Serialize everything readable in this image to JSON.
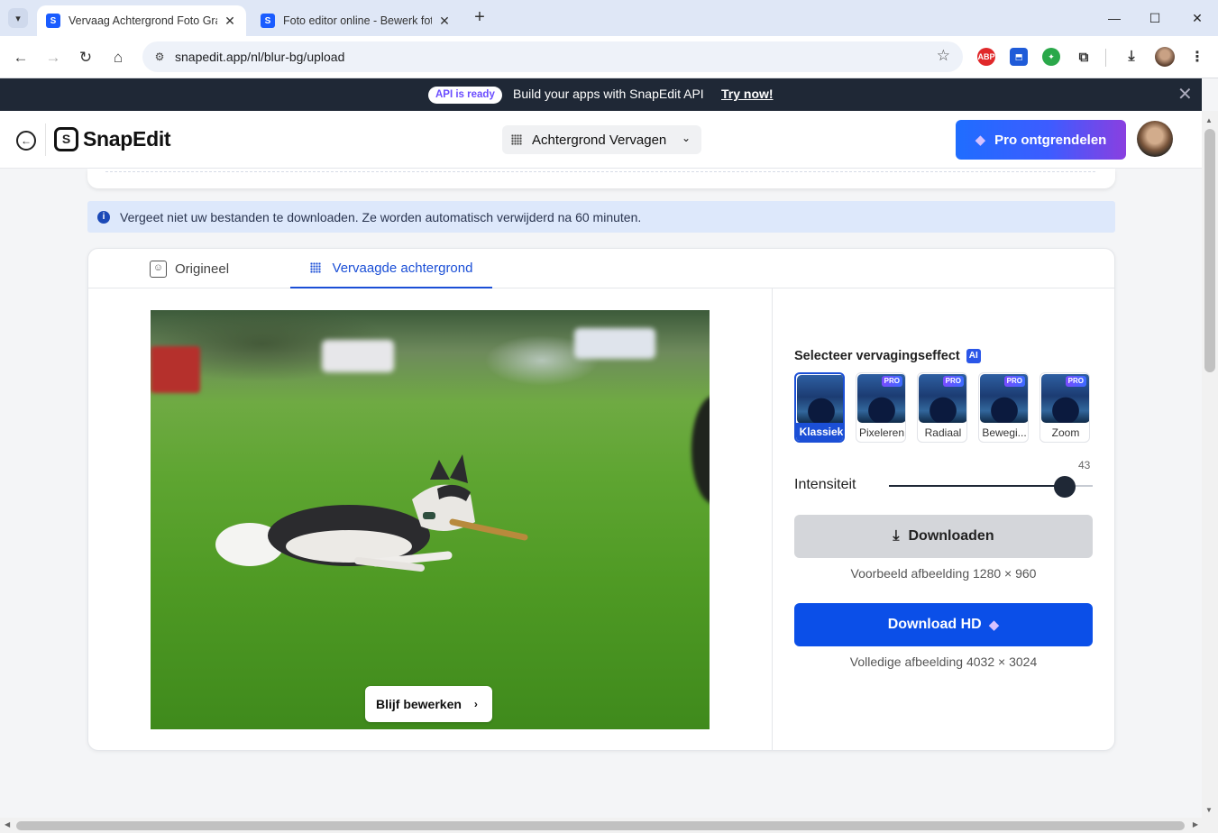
{
  "browser": {
    "tabs": [
      {
        "title": "Vervaag Achtergrond Foto Grat",
        "favicon": "S"
      },
      {
        "title": "Foto editor online - Bewerk foto",
        "favicon": "S"
      }
    ],
    "url": "snapedit.app/nl/blur-bg/upload",
    "extensions": {
      "abp": "ABP"
    }
  },
  "banner": {
    "pill": "API is ready",
    "text": "Build your apps with SnapEdit API",
    "link": "Try now!"
  },
  "header": {
    "logo": "SnapEdit",
    "logo_mark": "S",
    "tool": "Achtergrond Vervagen",
    "pro_button": "Pro ontgrendelen"
  },
  "notice": {
    "text": "Vergeet niet uw bestanden te downloaden. Ze worden automatisch verwijderd na 60 minuten."
  },
  "tabs": {
    "original": "Origineel",
    "blurred": "Vervaagde achtergrond"
  },
  "canvas": {
    "keep_editing": "Blijf bewerken"
  },
  "panel": {
    "effect_title": "Selecteer vervagingseffect",
    "ai_badge": "AI",
    "pro_tag": "PRO",
    "effects": [
      {
        "label": "Klassiek",
        "pro": false,
        "selected": true
      },
      {
        "label": "Pixeleren",
        "pro": true,
        "selected": false
      },
      {
        "label": "Radiaal",
        "pro": true,
        "selected": false
      },
      {
        "label": "Bewegi...",
        "pro": true,
        "selected": false
      },
      {
        "label": "Zoom",
        "pro": true,
        "selected": false
      }
    ],
    "intensity_label": "Intensiteit",
    "intensity_value": "43",
    "download_label": "Downloaden",
    "download_note": "Voorbeeld afbeelding 1280 × 960",
    "download_hd_label": "Download HD",
    "download_hd_note": "Volledige afbeelding 4032 × 3024"
  },
  "colors": {
    "accent": "#1b4fd6",
    "hd_button": "#0b4fe8",
    "banner_bg": "#1f2836"
  }
}
